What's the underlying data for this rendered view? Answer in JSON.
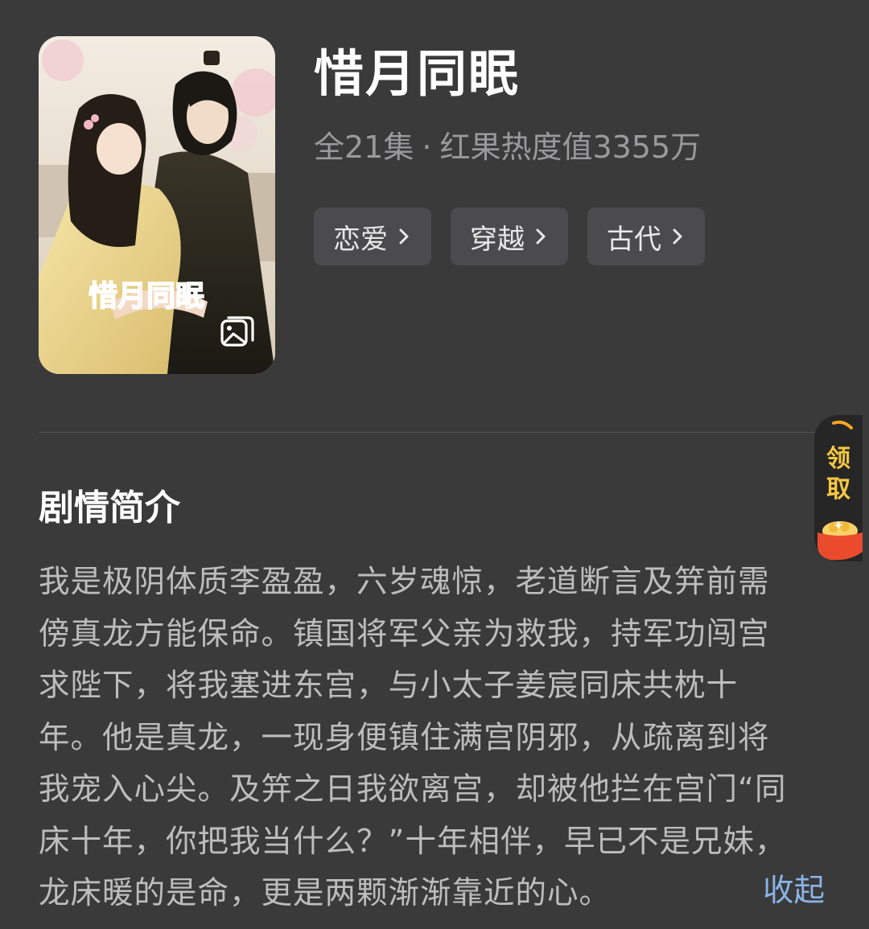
{
  "drama": {
    "title": "惜月同眠",
    "episodes": "全21集",
    "separator": "·",
    "heat": "红果热度值3355万",
    "cover_title_art": "惜月同眠",
    "tags": [
      {
        "label": "恋爱"
      },
      {
        "label": "穿越"
      },
      {
        "label": "古代"
      }
    ]
  },
  "synopsis": {
    "heading": "剧情简介",
    "lines": [
      "我是极阴体质李盈盈，六岁魂惊，老道断言及笄前需",
      "傍真龙方能保命。镇国将军父亲为救我，持军功闯宫",
      "求陛下，将我塞进东宫，与小太子姜宸同床共枕十",
      "年。他是真龙，一现身便镇住满宫阴邪，从疏离到将",
      "我宠入心尖。及笄之日我欲离宫，却被他拦在宫门“同",
      "床十年，你把我当什么？”十年相伴，早已不是兄妹，",
      "龙床暖的是命，更是两颗渐渐靠近的心。"
    ],
    "collapse_label": "收起"
  },
  "reward_widget": {
    "label": "领取"
  },
  "colors": {
    "background": "#3a3a3b",
    "accent_link": "#8ab4e6",
    "reward_text": "#f5c842"
  }
}
